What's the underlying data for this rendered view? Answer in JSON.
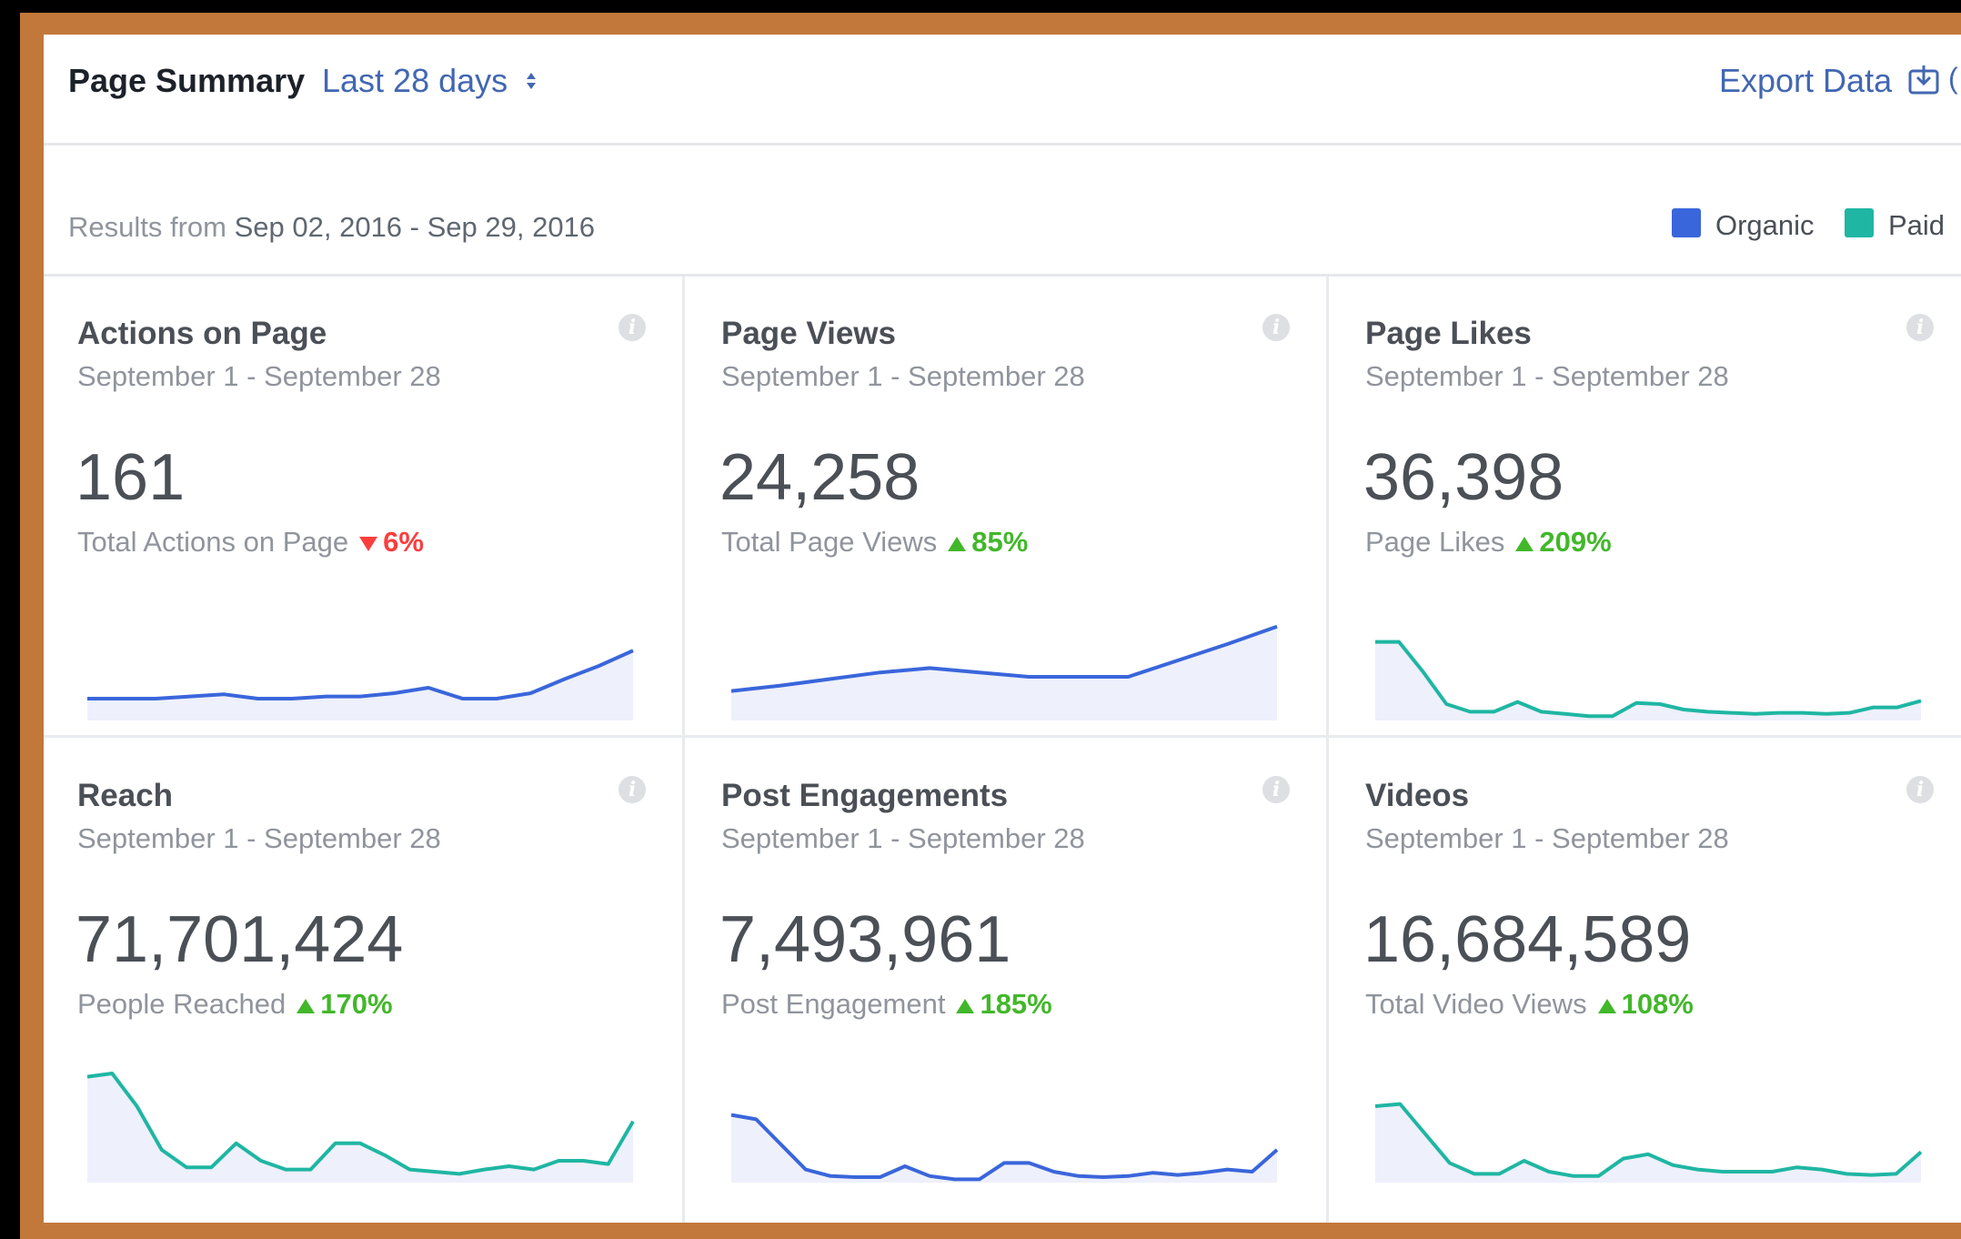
{
  "header": {
    "title": "Page Summary",
    "range_label": "Last 28 days",
    "export_label": "Export Data",
    "export_cut": "("
  },
  "results": {
    "prefix": "Results from",
    "range": "Sep 02, 2016 - Sep 29, 2016"
  },
  "legend": [
    {
      "label": "Organic",
      "color": "#3a66db"
    },
    {
      "label": "Paid",
      "color": "#1fb6a3"
    }
  ],
  "colors": {
    "up": "#42b72a",
    "down": "#fa3e3e",
    "fill": "#eef0fb"
  },
  "cards": [
    {
      "title": "Actions on Page",
      "dates": "September 1 - September 28",
      "value": "161",
      "label": "Total Actions on Page",
      "direction": "down",
      "change": "6%",
      "series_color": "#3a66db",
      "spark": [
        0.2,
        0.2,
        0.2,
        0.22,
        0.24,
        0.2,
        0.2,
        0.22,
        0.22,
        0.25,
        0.3,
        0.2,
        0.2,
        0.25,
        0.38,
        0.5,
        0.64
      ]
    },
    {
      "title": "Page Views",
      "dates": "September 1 - September 28",
      "value": "24,258",
      "label": "Total Page Views",
      "direction": "up",
      "change": "85%",
      "series_color": "#3a66db",
      "spark": [
        0.27,
        0.32,
        0.38,
        0.44,
        0.48,
        0.44,
        0.4,
        0.4,
        0.4,
        0.55,
        0.7,
        0.86
      ]
    },
    {
      "title": "Page Likes",
      "dates": "September 1 - September 28",
      "value": "36,398",
      "label": "Page Likes",
      "direction": "up",
      "change": "209%",
      "series_color": "#1fb6a3",
      "spark": [
        0.72,
        0.72,
        0.45,
        0.15,
        0.08,
        0.08,
        0.17,
        0.08,
        0.06,
        0.04,
        0.04,
        0.16,
        0.15,
        0.1,
        0.08,
        0.07,
        0.06,
        0.07,
        0.07,
        0.06,
        0.07,
        0.12,
        0.12,
        0.18
      ]
    },
    {
      "title": "Reach",
      "dates": "September 1 - September 28",
      "value": "71,701,424",
      "label": "People Reached",
      "direction": "up",
      "change": "170%",
      "series_color": "#1fb6a3",
      "spark": [
        0.97,
        1.0,
        0.7,
        0.3,
        0.14,
        0.14,
        0.36,
        0.2,
        0.12,
        0.12,
        0.36,
        0.36,
        0.25,
        0.12,
        0.1,
        0.08,
        0.12,
        0.15,
        0.12,
        0.2,
        0.2,
        0.17,
        0.56
      ]
    },
    {
      "title": "Post Engagements",
      "dates": "September 1 - September 28",
      "value": "7,493,961",
      "label": "Post Engagement",
      "direction": "up",
      "change": "185%",
      "series_color": "#3a66db",
      "spark": [
        0.62,
        0.58,
        0.35,
        0.12,
        0.06,
        0.05,
        0.05,
        0.15,
        0.06,
        0.03,
        0.03,
        0.18,
        0.18,
        0.1,
        0.06,
        0.05,
        0.06,
        0.09,
        0.07,
        0.09,
        0.12,
        0.1,
        0.3
      ]
    },
    {
      "title": "Videos",
      "dates": "September 1 - September 28",
      "value": "16,684,589",
      "label": "Total Video Views",
      "direction": "up",
      "change": "108%",
      "series_color": "#1fb6a3",
      "spark": [
        0.7,
        0.72,
        0.45,
        0.18,
        0.08,
        0.08,
        0.2,
        0.1,
        0.06,
        0.06,
        0.22,
        0.26,
        0.16,
        0.12,
        0.1,
        0.1,
        0.1,
        0.14,
        0.12,
        0.08,
        0.07,
        0.08,
        0.28
      ]
    }
  ]
}
